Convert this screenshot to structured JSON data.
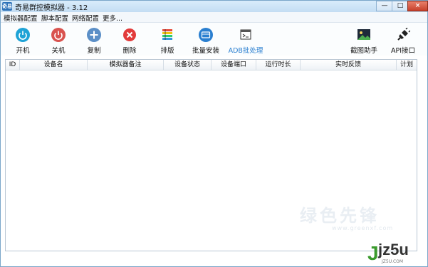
{
  "window": {
    "title": "奇易群控模拟器 - 3.12",
    "logo_text": "奇易"
  },
  "controls": {
    "minimize": "—",
    "maximize": "□",
    "close": "×"
  },
  "menu": [
    {
      "label": "模拟器配置"
    },
    {
      "label": "脚本配置"
    },
    {
      "label": "网络配置"
    },
    {
      "label": "更多..."
    }
  ],
  "toolbar": [
    {
      "label": "开机",
      "icon": "power-on-icon",
      "color": "#1fa3d6"
    },
    {
      "label": "关机",
      "icon": "power-off-icon",
      "color": "#d9534f"
    },
    {
      "label": "复制",
      "icon": "plus-icon",
      "color": "#5b8fc7"
    },
    {
      "label": "删除",
      "icon": "delete-icon",
      "color": "#e23b3b"
    },
    {
      "label": "排版",
      "icon": "layout-icon"
    },
    {
      "label": "批量安装",
      "icon": "batch-install-icon",
      "color": "#2a7fd0"
    },
    {
      "label": "ADB批处理",
      "icon": "terminal-icon",
      "color": "#2a7fd0"
    },
    {
      "label": "截图助手",
      "icon": "image-icon"
    },
    {
      "label": "API接口",
      "icon": "plug-icon"
    }
  ],
  "table": {
    "columns": [
      "ID",
      "设备名",
      "模拟器备注",
      "设备状态",
      "设备端口",
      "运行时长",
      "实时反馈",
      "计划"
    ],
    "rows": []
  },
  "watermark": {
    "text": "绿色先锋",
    "url": "www.greenxf.com"
  },
  "brand": {
    "logo": "jz5u",
    "url": "JZ5U.COM"
  }
}
